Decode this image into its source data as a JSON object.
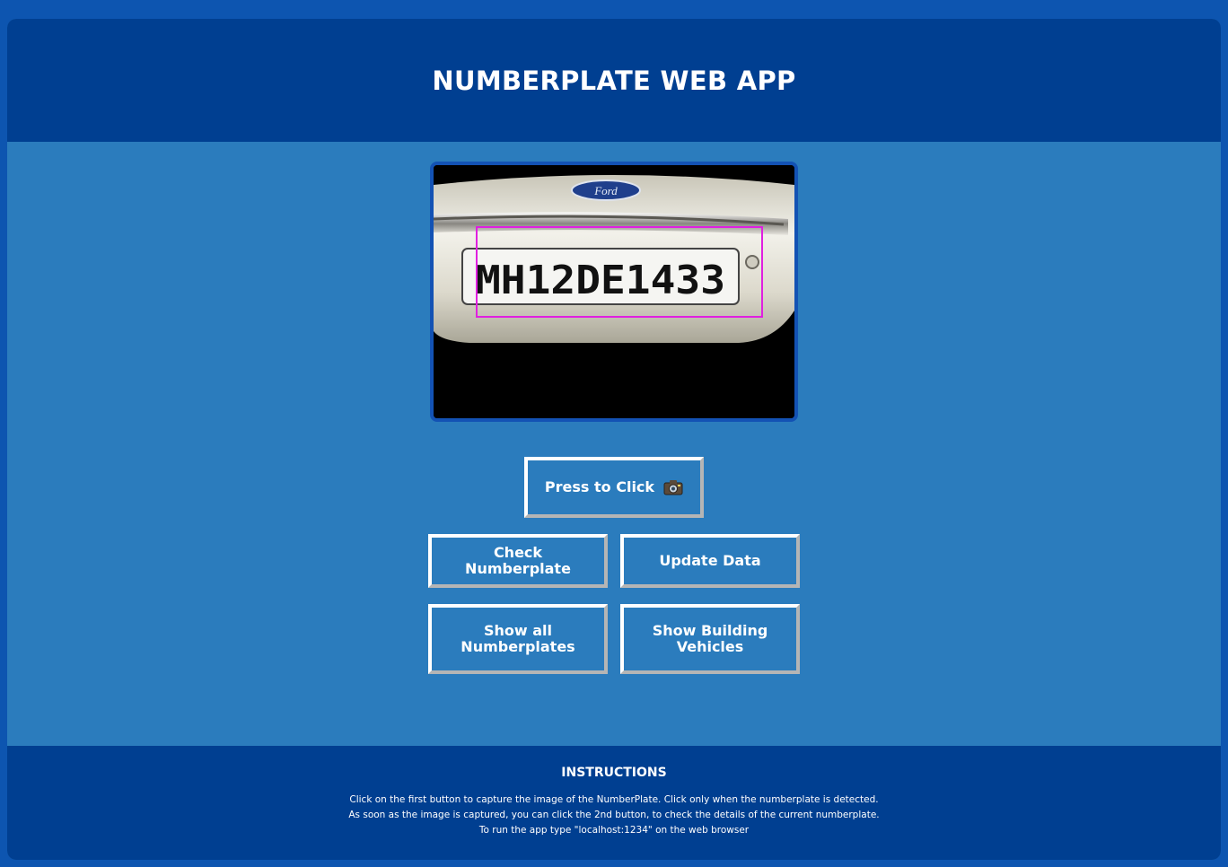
{
  "header": {
    "title": "NUMBERPLATE WEB APP"
  },
  "camera": {
    "plate_text": "MH12DE1433",
    "car_brand": "Ford",
    "detection_box_color": "#e020e0"
  },
  "buttons": {
    "capture_label": "Press to Click",
    "capture_icon": "camera-icon",
    "check_label": "Check Numberplate",
    "update_label": "Update Data",
    "show_all_label": "Show all Numberplates",
    "show_building_label": "Show Building Vehicles"
  },
  "instructions": {
    "title": "INSTRUCTIONS",
    "lines": [
      "Click on the first button to capture the image of the NumberPlate. Click only when the numberplate is detected.",
      "As soon as the image is captured, you can click the 2nd button, to check the details of the current numberplate.",
      "To run the app type \"localhost:1234\" on the web browser"
    ]
  },
  "colors": {
    "page_bg": "#0d55b0",
    "panel_bg": "#2b7cbd",
    "header_bg": "#003f91",
    "text": "#ffffff"
  }
}
